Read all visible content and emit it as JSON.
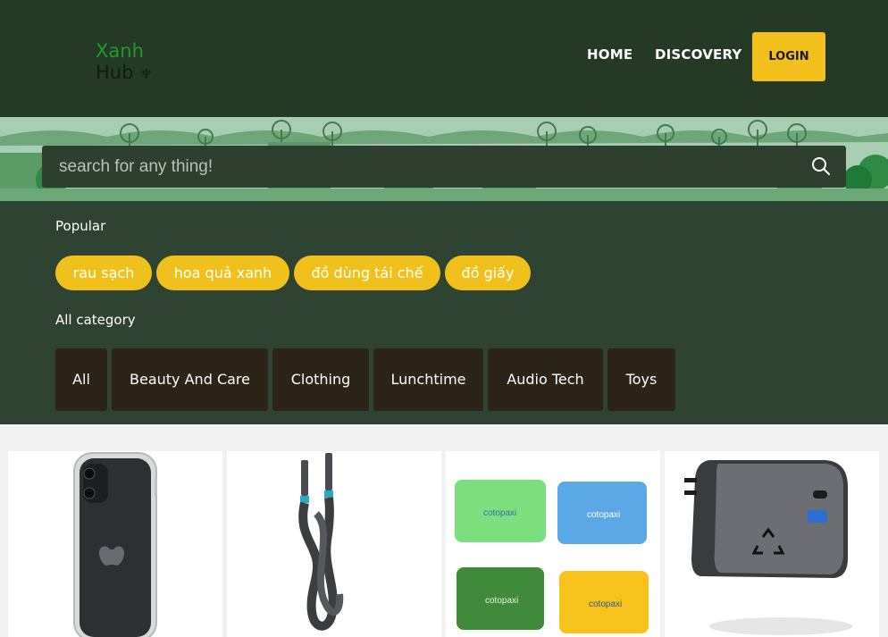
{
  "brand": {
    "line1": "Xanh",
    "line2": "Hub"
  },
  "nav": {
    "home": "HOME",
    "discovery": "DISCOVERY",
    "login": "LOGIN"
  },
  "search": {
    "placeholder": "search for any thing!",
    "value": ""
  },
  "popular": {
    "title": "Popular",
    "tags": [
      "rau sạch",
      "hoa quả xanh",
      "đồ dùng tái chế",
      "đồ giấy"
    ]
  },
  "categories": {
    "title": "All category",
    "items": [
      "All",
      "Beauty And Care",
      "Clothing",
      "Lunchtime",
      "Audio Tech",
      "Toys"
    ]
  },
  "products": [
    {
      "name": "clear phone case",
      "brand_text": ""
    },
    {
      "name": "braided charging cable",
      "brand_text": ""
    },
    {
      "name": "cotopaxi pouches",
      "brand_text": "cotopaxi"
    },
    {
      "name": "wall charger",
      "brand_text": ""
    }
  ],
  "colors": {
    "header_bg": "#243a25",
    "filter_bg": "#2e4332",
    "accent": "#f0c11c",
    "category_bg": "#2d2418"
  }
}
